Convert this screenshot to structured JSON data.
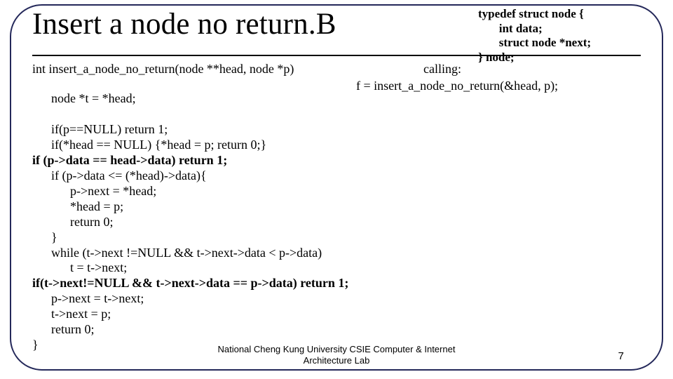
{
  "title": "Insert a node no return.B",
  "typedef": {
    "l1": "typedef struct node {",
    "l2": "       int data;",
    "l3": "       struct node *next;",
    "l4": "} node;"
  },
  "signature": "int insert_a_node_no_return(node **head, node *p)",
  "calling_label": "calling:",
  "calling_code": "f = insert_a_node_no_return(&head, p);",
  "code": {
    "l1": "      node *t = *head;",
    "l2": "",
    "l3": "      if(p==NULL) return 1;",
    "l4": "      if(*head == NULL) {*head = p; return 0;}",
    "l5": "if (p->data == head->data) return 1;",
    "l6": "      if (p->data <= (*head)->data){",
    "l7": "            p->next = *head;",
    "l8": "            *head = p;",
    "l9": "            return 0;",
    "l10": "      }",
    "l11": "      while (t->next !=NULL && t->next->data < p->data)",
    "l12": "            t = t->next;",
    "l13": "if(t->next!=NULL && t->next->data == p->data) return 1;",
    "l14": "      p->next = t->next;",
    "l15": "      t->next = p;",
    "l16": "      return 0;",
    "l17": "}"
  },
  "footer": {
    "line1": "National Cheng Kung University CSIE Computer & Internet",
    "line2": "Architecture Lab"
  },
  "page_number": "7"
}
